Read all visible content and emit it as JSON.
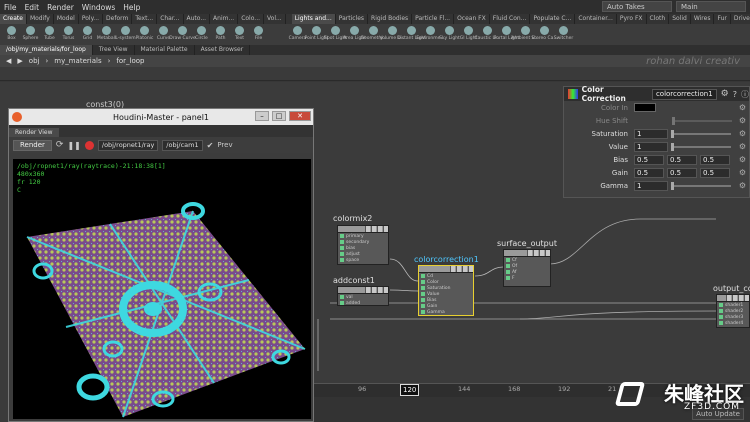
{
  "menu": [
    "File",
    "Edit",
    "Render",
    "Windows",
    "Help"
  ],
  "top_right": {
    "takes": "Auto Takes",
    "desktop": "Main"
  },
  "shelf_tabs_left": [
    "Create",
    "Modify",
    "Model",
    "Poly...",
    "Deform",
    "Text...",
    "Char...",
    "Auto...",
    "Anim...",
    "Colo...",
    "Vol..."
  ],
  "shelf_tabs_right": [
    "Lights and...",
    "Particles",
    "Rigid Bodies",
    "Particle Fl...",
    "Ocean FX",
    "Fluid Con...",
    "Populate C...",
    "Container...",
    "Pyro FX",
    "Cloth",
    "Solid",
    "Wires",
    "Fur",
    "Drive Sim..."
  ],
  "tools_left": [
    "Box",
    "Sphere",
    "Tube",
    "Torus",
    "Grid",
    "Metaball",
    "L-system",
    "Platonic",
    "Curve",
    "Draw Curve",
    "Circle",
    "Path",
    "Text",
    "File"
  ],
  "tools_right": [
    "Camera",
    "Point Light",
    "Spot Light",
    "Area Light",
    "Geometry...",
    "Volume Li...",
    "Distant Light",
    "Environme...",
    "Sky Light",
    "GI Light",
    "Caustic Li...",
    "Portal Light",
    "Ambient Li...",
    "Stereo Ca...",
    "Switcher"
  ],
  "pane_tabs": [
    "/obj/my_materials/for_loop",
    "Tree View",
    "Material Palette",
    "Asset Browser"
  ],
  "path": [
    "obj",
    "my_materials",
    "for_loop"
  ],
  "netview_overlay": "rohan dalvi creativ",
  "node_partial_label": "const3(0)",
  "render_window": {
    "title": "Houdini-Master - panel1",
    "tab": "Render View",
    "render_button": "Render",
    "rop_path": "/obj/ropnet1/ray",
    "cam_path": "/obj/cam1",
    "prev_label": "Prev",
    "info": [
      "/obj/ropnet1/ray(raytrace)-21:18:38[1]",
      "480x360",
      "fr 120",
      "C"
    ]
  },
  "nodes": {
    "colormix2": {
      "label": "colormix2",
      "rows": [
        "primary",
        "secondary",
        "bias",
        "adjust",
        "space"
      ]
    },
    "addconst1": {
      "label": "addconst1",
      "rows": [
        "val",
        "added"
      ]
    },
    "colorcorrection1": {
      "label": "colorcorrection1",
      "rows": [
        "Cd",
        "Color",
        "Saturation",
        "Value",
        "Bias",
        "Gain",
        "Gamma"
      ]
    },
    "surface_output": {
      "label": "surface_output",
      "rows": [
        "Cf",
        "Of",
        "Af",
        "F"
      ]
    },
    "output_collect": {
      "label": "output_co",
      "rows": [
        "shader1",
        "shader2",
        "shader3",
        "shader4"
      ]
    }
  },
  "params": {
    "title": "Color Correction",
    "node_name": "colorcorrection1",
    "rows": [
      {
        "label": "Color In",
        "values": [],
        "dim": true
      },
      {
        "label": "Hue Shift",
        "values": [],
        "dim": true
      },
      {
        "label": "Saturation",
        "values": [
          "1"
        ],
        "dim": false
      },
      {
        "label": "Value",
        "values": [
          "1"
        ],
        "dim": false
      },
      {
        "label": "Bias",
        "values": [
          "0.5",
          "0.5",
          "0.5"
        ],
        "dim": false
      },
      {
        "label": "Gain",
        "values": [
          "0.5",
          "0.5",
          "0.5"
        ],
        "dim": false
      },
      {
        "label": "Gamma",
        "values": [
          "1"
        ],
        "dim": false
      }
    ]
  },
  "timeline": {
    "ticks": [
      "96",
      "120",
      "144",
      "168",
      "192",
      "21"
    ],
    "current": "120"
  },
  "status": {
    "auto_update": "Auto Update"
  },
  "watermark": {
    "brand": "朱峰社区",
    "url": "ZF3D.COM"
  }
}
